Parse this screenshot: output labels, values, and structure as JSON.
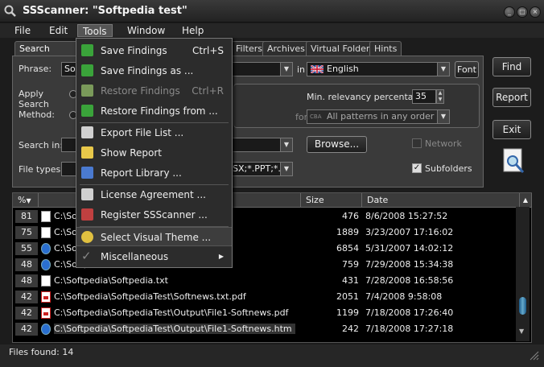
{
  "window": {
    "title": "SSScanner: \"Softpedia test\"",
    "min_glyph": "_",
    "max_glyph": "□",
    "close_glyph": "×"
  },
  "menubar": {
    "items": [
      "File",
      "Edit",
      "Tools",
      "Window",
      "Help"
    ]
  },
  "tabs": [
    "Search Phrase",
    "Filters",
    "Archives",
    "Virtual Folders",
    "Hints"
  ],
  "search": {
    "phrase_label": "Phrase:",
    "phrase_value": "So",
    "in_label": "in",
    "language": "English",
    "font_button": "Font",
    "apply_label_1": "Apply",
    "apply_label_2": "Search",
    "apply_label_3": "Method:",
    "relevancy_label": "Min. relevancy percentage:",
    "relevancy_value": "35",
    "for_label": "for",
    "patterns_value": "All patterns in any order",
    "search_in_label": "Search in:",
    "browse_button": "Browse...",
    "network_label": "Network",
    "file_types_label": "File types:",
    "file_types_value": "SX;*.PPT;*.F",
    "subfolders_label": "Subfolders"
  },
  "side_buttons": {
    "find": "Find",
    "report": "Report",
    "exit": "Exit"
  },
  "list": {
    "columns": [
      "%",
      "Size",
      "Date"
    ],
    "rows": [
      {
        "rel": "81",
        "icon": "doc",
        "path": "C:\\Softpedia\\",
        "size": "476",
        "date": "8/6/2008 15:27:52"
      },
      {
        "rel": "75",
        "icon": "doc",
        "path": "C:\\Softpedia\\",
        "size": "1889",
        "date": "3/23/2007 17:16:02"
      },
      {
        "rel": "55",
        "icon": "ie",
        "path": "C:\\Softpedia\\",
        "size": "6854",
        "date": "5/31/2007 14:02:12"
      },
      {
        "rel": "48",
        "icon": "ie",
        "path": "C:\\Softpedia\\",
        "size": "759",
        "date": "7/29/2008 15:34:38"
      },
      {
        "rel": "48",
        "icon": "doc",
        "path": "C:\\Softpedia\\Softpedia.txt",
        "size": "431",
        "date": "7/28/2008 16:58:56"
      },
      {
        "rel": "42",
        "icon": "pdf",
        "path": "C:\\Softpedia\\SoftpediaTest\\Softnews.txt.pdf",
        "size": "2051",
        "date": "7/4/2008 9:58:08"
      },
      {
        "rel": "42",
        "icon": "pdf",
        "path": "C:\\Softpedia\\SoftpediaTest\\Output\\File1-Softnews.pdf",
        "size": "1199",
        "date": "7/18/2008 17:26:40"
      },
      {
        "rel": "42",
        "icon": "ie",
        "path": "C:\\Softpedia\\SoftpediaTest\\Output\\File1-Softnews.htm",
        "size": "242",
        "date": "7/18/2008 17:27:18"
      }
    ]
  },
  "status": {
    "text": "Files found: 14"
  },
  "tools_menu": {
    "items": [
      {
        "label": "Save Findings",
        "shortcut": "Ctrl+S",
        "enabled": true,
        "color": "#3aa33a"
      },
      {
        "label": "Save Findings as ...",
        "shortcut": "",
        "enabled": true,
        "color": "#3aa33a"
      },
      {
        "label": "Restore Findings",
        "shortcut": "Ctrl+R",
        "enabled": false,
        "color": "#7a9a5a"
      },
      {
        "label": "Restore Findings from ...",
        "shortcut": "",
        "enabled": true,
        "color": "#3aa33a"
      },
      {
        "label": "Export File List ...",
        "shortcut": "",
        "enabled": true,
        "color": "#d0d0d0"
      },
      {
        "label": "Show Report",
        "shortcut": "",
        "enabled": true,
        "color": "#e8c84a"
      },
      {
        "label": "Report Library ...",
        "shortcut": "",
        "enabled": true,
        "color": "#4a7ad0"
      },
      {
        "label": "License Agreement ...",
        "shortcut": "",
        "enabled": true,
        "color": "#d0d0d0"
      },
      {
        "label": "Register SSScanner ...",
        "shortcut": "",
        "enabled": true,
        "color": "#c04040"
      },
      {
        "label": "Select Visual Theme ...",
        "shortcut": "",
        "enabled": true,
        "color": "#e0c040"
      },
      {
        "label": "Miscellaneous",
        "shortcut": "",
        "enabled": true,
        "color": "#888888",
        "submenu": true
      }
    ]
  },
  "colors": {
    "accent": "#555555",
    "background": "#1c1c1c",
    "list_background": "#000000"
  }
}
